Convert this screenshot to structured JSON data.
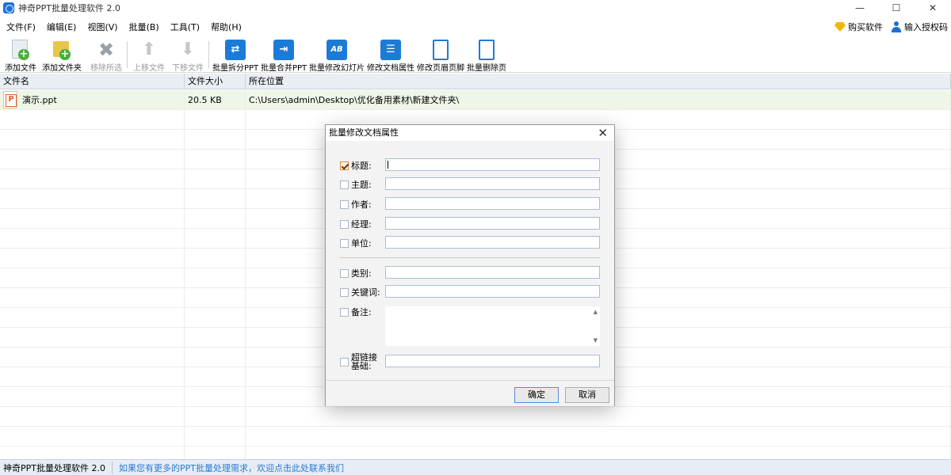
{
  "window": {
    "title": "神奇PPT批量处理软件 2.0",
    "minimize": "—",
    "maximize": "☐",
    "close": "✕"
  },
  "menu": {
    "items": [
      "文件(F)",
      "编辑(E)",
      "视图(V)",
      "批量(B)",
      "工具(T)",
      "帮助(H)"
    ],
    "buy": "购买软件",
    "license": "输入授权码"
  },
  "toolbar": {
    "add_file": "添加文件",
    "add_folder": "添加文件夹",
    "remove_selected": "移除所选",
    "move_up": "上移文件",
    "move_down": "下移文件",
    "batch_split": "批量拆分PPT",
    "batch_merge": "批量合并PPT",
    "batch_modify_slides": "批量修改幻灯片",
    "modify_properties": "修改文档属性",
    "modify_header_footer": "修改页眉页脚",
    "batch_delete_pages": "批量删除页",
    "slides_icon_text": "AB"
  },
  "table": {
    "headers": {
      "name": "文件名",
      "size": "文件大小",
      "path": "所在位置"
    },
    "rows": [
      {
        "name": "演示.ppt",
        "size": "20.5 KB",
        "path": "C:\\Users\\admin\\Desktop\\优化备用素材\\新建文件夹\\"
      }
    ]
  },
  "status": {
    "app": "神奇PPT批量处理软件 2.0",
    "link": "如果您有更多的PPT批量处理需求，欢迎点击此处联系我们"
  },
  "dialog": {
    "title": "批量修改文档属性",
    "close": "✕",
    "fields": {
      "title": {
        "label": "标题:",
        "checked": true,
        "value": ""
      },
      "subject": {
        "label": "主题:",
        "checked": false,
        "value": ""
      },
      "author": {
        "label": "作者:",
        "checked": false,
        "value": ""
      },
      "manager": {
        "label": "经理:",
        "checked": false,
        "value": ""
      },
      "company": {
        "label": "单位:",
        "checked": false,
        "value": ""
      },
      "category": {
        "label": "类别:",
        "checked": false,
        "value": ""
      },
      "keywords": {
        "label": "关键词:",
        "checked": false,
        "value": ""
      },
      "comments": {
        "label": "备注:",
        "checked": false,
        "value": ""
      },
      "hyperlink_line1": "超链接",
      "hyperlink_line2": "基础:",
      "hyperlink_value": ""
    },
    "scroll_up": "▲",
    "scroll_down": "▼",
    "ok": "确定",
    "cancel": "取消"
  }
}
